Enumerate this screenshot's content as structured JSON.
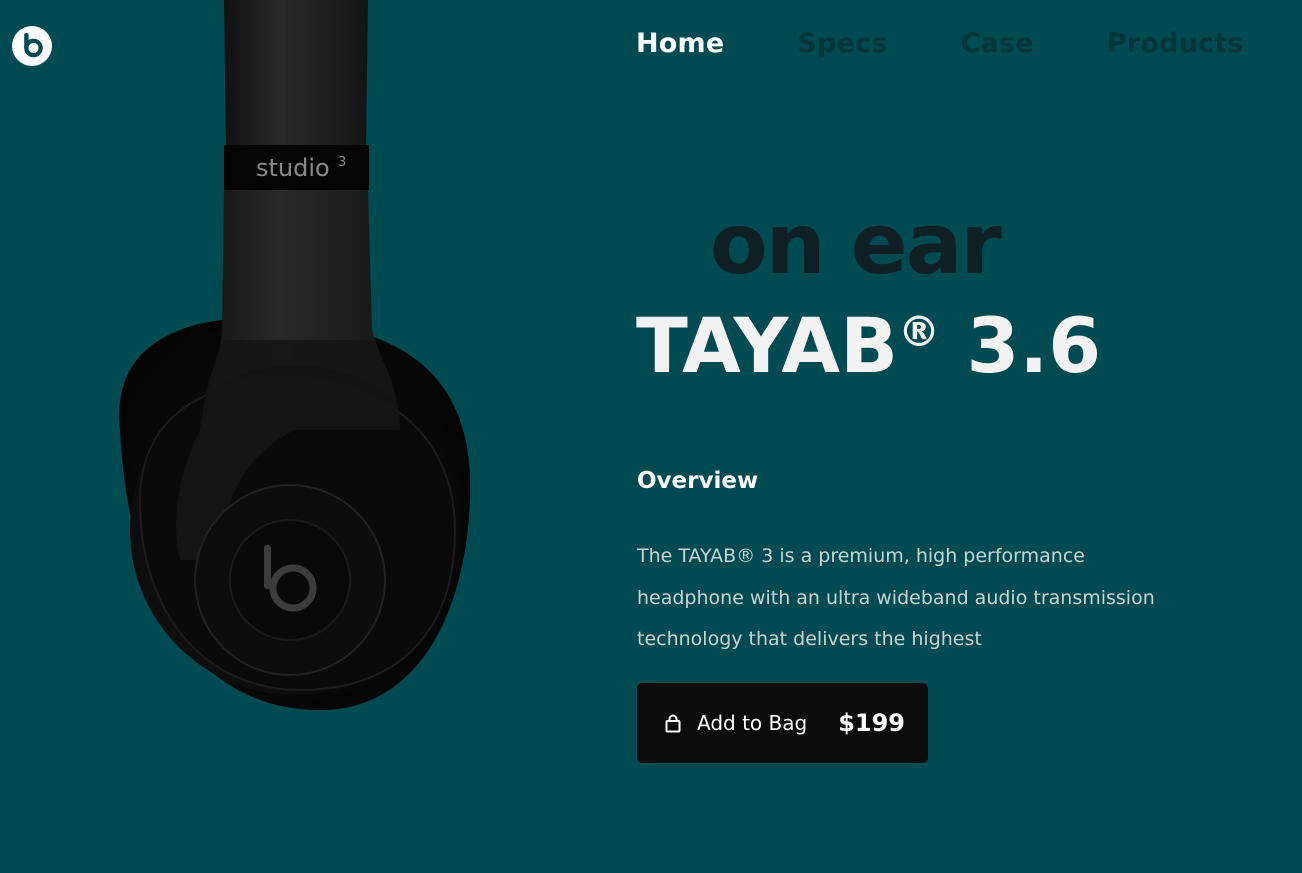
{
  "brand": {
    "logo_icon": "beats-logo-icon"
  },
  "nav": {
    "items": [
      {
        "label": "Home",
        "active": true
      },
      {
        "label": "Specs",
        "active": false
      },
      {
        "label": "Case",
        "active": false
      },
      {
        "label": "Products",
        "active": false
      }
    ]
  },
  "hero": {
    "tagline": "on ear",
    "title_name": "TAYAB",
    "title_mark": "®",
    "title_version": "3.6",
    "overview_heading": "Overview",
    "description": "The TAYAB® 3 is a premium, high performance headphone with an ultra wideband audio transmission technology that delivers the highest",
    "product_image_text": "studio",
    "product_image_superscript": "3"
  },
  "cta": {
    "label": "Add to Bag",
    "price": "$199",
    "icon": "shopping-bag-icon"
  },
  "colors": {
    "background": "#004a52",
    "button": "#0b0b0b",
    "nav_inactive": "#05363b",
    "tagline": "#0e2023"
  }
}
